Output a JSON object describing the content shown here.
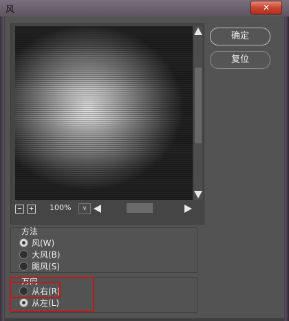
{
  "window": {
    "title": "风",
    "close_icon": "close-icon ✕"
  },
  "buttons": {
    "ok": "确定",
    "reset": "复位"
  },
  "preview": {
    "zoom": "100%",
    "zoom_out_glyph": "−",
    "zoom_in_glyph": "+",
    "dropdown_glyph": "∨"
  },
  "method": {
    "label": "方法",
    "options": [
      "风(W)",
      "大风(B)",
      "飓风(S)"
    ],
    "selected": 0
  },
  "direction": {
    "label": "方向",
    "options": [
      "从右(R)",
      "从左(L)"
    ],
    "selected": 1
  },
  "colors": {
    "highlight": "#c81414",
    "close": "#c9452f"
  }
}
